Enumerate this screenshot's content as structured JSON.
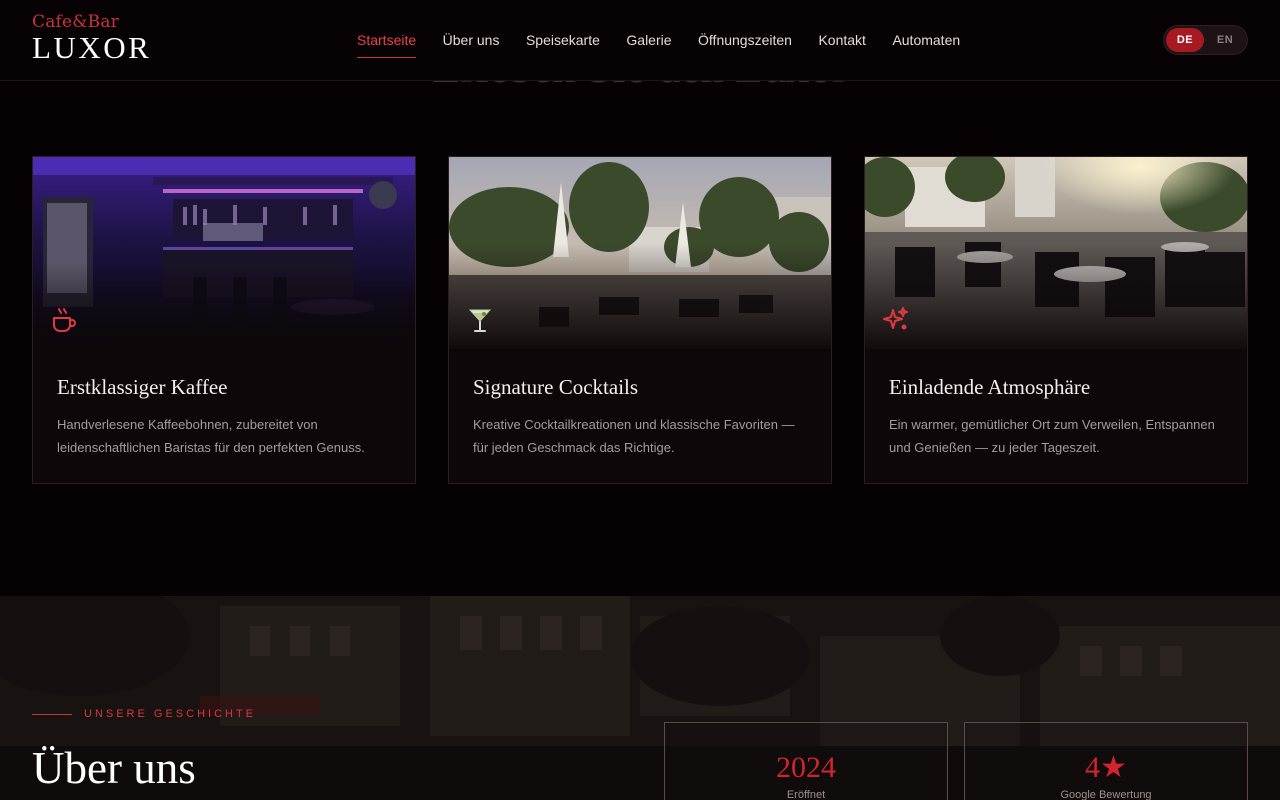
{
  "brand": {
    "sub": "Cafe&Bar",
    "name": "LUXOR"
  },
  "nav": {
    "items": [
      {
        "label": "Startseite",
        "active": true
      },
      {
        "label": "Über uns"
      },
      {
        "label": "Speisekarte"
      },
      {
        "label": "Galerie"
      },
      {
        "label": "Öffnungszeiten"
      },
      {
        "label": "Kontakt"
      },
      {
        "label": "Automaten"
      }
    ],
    "lang": {
      "de": "DE",
      "en": "EN",
      "selected": "DE"
    }
  },
  "section": {
    "heading": "Erleben Sie den Luxor"
  },
  "cards": [
    {
      "icon": "coffee-cup-icon",
      "title": "Erstklassiger Kaffee",
      "text": "Handverlesene Kaffeebohnen, zubereitet von leidenschaftlichen Baristas für den perfekten Genuss."
    },
    {
      "icon": "cocktail-glass-icon",
      "title": "Signature Cocktails",
      "text": "Kreative Cocktailkreationen und klassische Favoriten — für jeden Geschmack das Richtige."
    },
    {
      "icon": "sparkles-icon",
      "title": "Einladende Atmosphäre",
      "text": "Ein warmer, gemütlicher Ort zum Verweilen, Entspannen und Genießen — zu jeder Tageszeit."
    }
  ],
  "about": {
    "eyebrow": "UNSERE GESCHICHTE",
    "title": "Über uns",
    "stats": [
      {
        "value": "2024",
        "label": "Eröffnet"
      },
      {
        "value": "4★",
        "label": "Google Bewertung"
      }
    ]
  },
  "colors": {
    "accent": "#c9343a",
    "background": "#060103",
    "card": "#0d0709"
  }
}
